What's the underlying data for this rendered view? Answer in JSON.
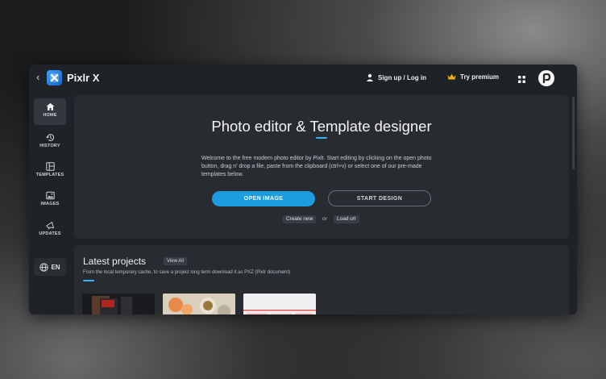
{
  "app": {
    "title": "Pixlr X",
    "back_icon": "chevron-left-icon",
    "logo_icon": "pixlr-x-logo"
  },
  "topbar": {
    "signup_label": "Sign up / Log in",
    "premium_label": "Try premium",
    "signup_icon": "user-icon",
    "premium_icon": "crown-icon",
    "apps_icon": "grid-icon",
    "account_icon": "pixlr-account-icon"
  },
  "sidebar": {
    "items": [
      {
        "label": "HOME",
        "icon": "home-icon"
      },
      {
        "label": "HISTORY",
        "icon": "history-icon"
      },
      {
        "label": "TEMPLATES",
        "icon": "templates-icon"
      },
      {
        "label": "IMAGES",
        "icon": "image-icon"
      },
      {
        "label": "UPDATES",
        "icon": "megaphone-icon"
      }
    ],
    "language": "EN",
    "language_icon": "globe-icon"
  },
  "hero": {
    "title": "Photo editor & Template designer",
    "description": "Welcome to the free modern photo editor by Pixlr. Start editing by clicking on the open photo button, drag n' drop a file, paste from the clipboard (ctrl+v) or select one of our pre-made templates below.",
    "open_button": "OPEN IMAGE",
    "start_button": "START DESIGN",
    "create_new": "Create new",
    "or_text": "or",
    "load_url": "Load url"
  },
  "latest": {
    "title": "Latest projects",
    "view_all": "View All",
    "subtitle": "From the local temporary cache, to save a project long term download it as PXZ (Pixlr document)"
  },
  "colors": {
    "accent": "#1d9ce0",
    "background": "#1f2226",
    "panel": "#282c31"
  }
}
